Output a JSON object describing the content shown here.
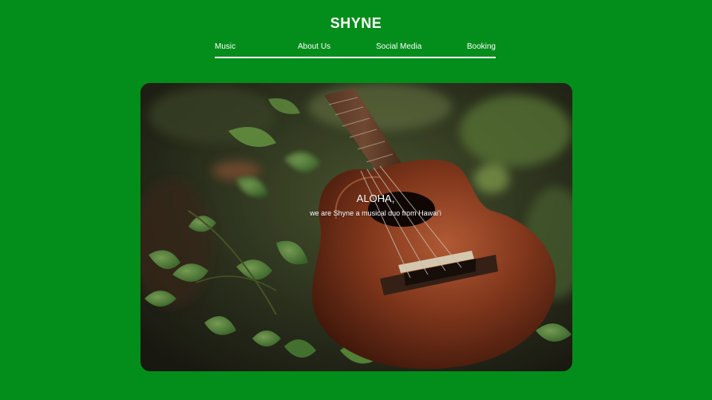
{
  "site": {
    "brand": "SHYNE"
  },
  "nav": {
    "items": [
      {
        "label": "Music"
      },
      {
        "label": "About Us"
      },
      {
        "label": "Social Media"
      },
      {
        "label": "Booking"
      }
    ]
  },
  "hero": {
    "title": "ALOHA,",
    "subtitle": "we are Shyne a musical duo from Hawai'i",
    "image_subject": "ukulele-on-forest-ground-photo"
  },
  "colors": {
    "background": "#038d1a",
    "text": "#ffffff"
  }
}
